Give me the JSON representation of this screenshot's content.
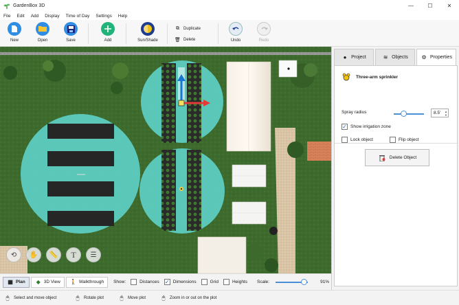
{
  "window": {
    "title": "GardenBox 3D",
    "minimize": "—",
    "maximize": "☐",
    "close": "✕"
  },
  "menu": [
    "File",
    "Edit",
    "Add",
    "Display",
    "Time of Day",
    "Settings",
    "Help"
  ],
  "toolbar": {
    "new": "New",
    "open": "Open",
    "save": "Save",
    "add": "Add",
    "sun_shade": "Sun/Shade",
    "duplicate": "Duplicate",
    "delete": "Delete",
    "undo": "Undo",
    "redo": "Redo"
  },
  "view_modes": {
    "plan": "Plan",
    "view3d": "3D View",
    "walkthrough": "Walkthrough"
  },
  "show": {
    "label": "Show:",
    "distances": {
      "label": "Distances",
      "checked": false
    },
    "dimensions": {
      "label": "Dimensions",
      "checked": true
    },
    "grid": {
      "label": "Grid",
      "checked": false
    },
    "heights": {
      "label": "Heights",
      "checked": false
    }
  },
  "scale": {
    "label": "Scale:",
    "value": "91%",
    "fraction": 0.91
  },
  "status": {
    "select": "Select and move object",
    "rotate": "Rotate plot",
    "move": "Move plot",
    "zoom": "Zoom in or out on the plot"
  },
  "panel": {
    "tabs": {
      "project": "Project",
      "objects": "Objects",
      "properties": "Properties"
    },
    "active_tab": "properties",
    "object_name": "Three-arm sprinkler",
    "spray_radius_label": "Spray radius",
    "spray_radius_value": "8.5'",
    "show_irrigation_label": "Show irrigation zone",
    "show_irrigation_checked": true,
    "lock_label": "Lock object",
    "lock_checked": false,
    "flip_label": "Flip object",
    "flip_checked": false,
    "delete_label": "Delete Object"
  },
  "colors": {
    "grass": "#3f6b2f",
    "irrigation_zone": "#5ed1c9",
    "accent": "#1976d2",
    "path": "#d8c3a5"
  },
  "icons": {
    "floating_tools": [
      "rotate-view-icon",
      "pan-hand-icon",
      "measure-icon",
      "text-icon",
      "layers-icon"
    ]
  }
}
